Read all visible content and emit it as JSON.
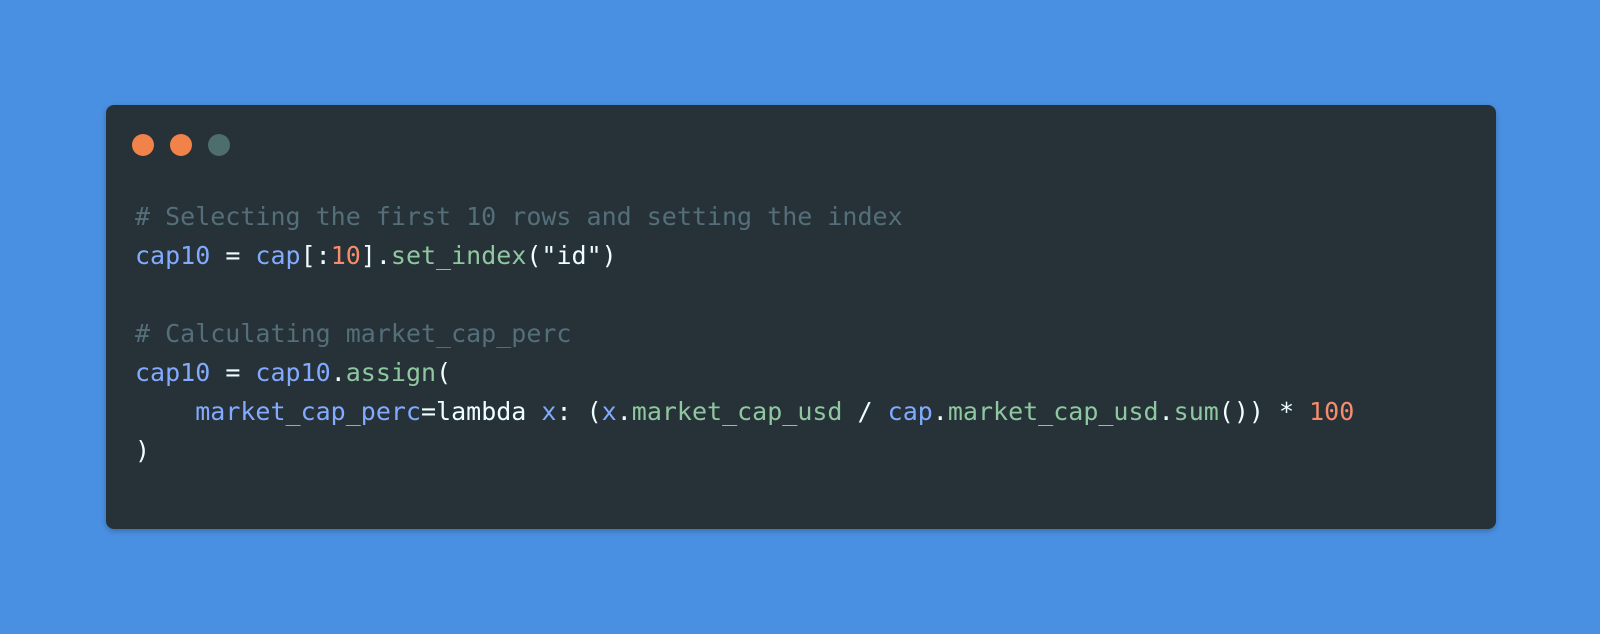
{
  "window": {
    "background": "#263238",
    "page_background": "#4a90e2",
    "controls": [
      {
        "name": "close",
        "color": "#f0824a"
      },
      {
        "name": "minimize",
        "color": "#f0824a"
      },
      {
        "name": "maximize",
        "color": "#4d6e6a"
      }
    ]
  },
  "colors": {
    "comment": "#546e7a",
    "variable": "#82aaff",
    "method": "#8fc7a0",
    "number": "#f78c6c",
    "plain": "#eeffff"
  },
  "code": {
    "lines": [
      [
        {
          "t": "# Selecting the first 10 rows and setting the index",
          "c": "comment"
        }
      ],
      [
        {
          "t": "cap10",
          "c": "variable"
        },
        {
          "t": " = ",
          "c": "plain"
        },
        {
          "t": "cap",
          "c": "variable"
        },
        {
          "t": "[:",
          "c": "plain"
        },
        {
          "t": "10",
          "c": "number"
        },
        {
          "t": "].",
          "c": "plain"
        },
        {
          "t": "set_index",
          "c": "method"
        },
        {
          "t": "(\"id\")",
          "c": "plain"
        }
      ],
      [],
      [
        {
          "t": "# Calculating market_cap_perc",
          "c": "comment"
        }
      ],
      [
        {
          "t": "cap10",
          "c": "variable"
        },
        {
          "t": " = ",
          "c": "plain"
        },
        {
          "t": "cap10",
          "c": "variable"
        },
        {
          "t": ".",
          "c": "plain"
        },
        {
          "t": "assign",
          "c": "method"
        },
        {
          "t": "(",
          "c": "plain"
        }
      ],
      [
        {
          "t": "    ",
          "c": "plain"
        },
        {
          "t": "market_cap_perc",
          "c": "variable"
        },
        {
          "t": "=lambda ",
          "c": "plain"
        },
        {
          "t": "x",
          "c": "variable"
        },
        {
          "t": ": (",
          "c": "plain"
        },
        {
          "t": "x",
          "c": "variable"
        },
        {
          "t": ".",
          "c": "plain"
        },
        {
          "t": "market_cap_usd",
          "c": "method"
        },
        {
          "t": " / ",
          "c": "plain"
        },
        {
          "t": "cap",
          "c": "variable"
        },
        {
          "t": ".",
          "c": "plain"
        },
        {
          "t": "market_cap_usd",
          "c": "method"
        },
        {
          "t": ".",
          "c": "plain"
        },
        {
          "t": "sum",
          "c": "method"
        },
        {
          "t": "()) * ",
          "c": "plain"
        },
        {
          "t": "100",
          "c": "number"
        }
      ],
      [
        {
          "t": ")",
          "c": "plain"
        }
      ]
    ]
  }
}
